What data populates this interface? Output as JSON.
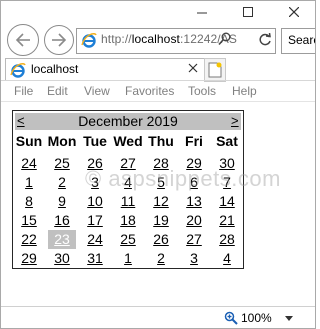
{
  "browser": {
    "url_prefix": "http://",
    "url_host": "localhost",
    "url_rest": ":12242/AS",
    "search_placeholder": "Search",
    "tab_title": "localhost",
    "menu": [
      "File",
      "Edit",
      "View",
      "Favorites",
      "Tools",
      "Help"
    ],
    "zoom": "100%"
  },
  "calendar": {
    "prev": "<",
    "next": ">",
    "title": "December 2019",
    "days_of_week": [
      "Sun",
      "Mon",
      "Tue",
      "Wed",
      "Thu",
      "Fri",
      "Sat"
    ],
    "weeks": [
      [
        "24",
        "25",
        "26",
        "27",
        "28",
        "29",
        "30"
      ],
      [
        "1",
        "2",
        "3",
        "4",
        "5",
        "6",
        "7"
      ],
      [
        "8",
        "9",
        "10",
        "11",
        "12",
        "13",
        "14"
      ],
      [
        "15",
        "16",
        "17",
        "18",
        "19",
        "20",
        "21"
      ],
      [
        "22",
        "23",
        "24",
        "25",
        "26",
        "27",
        "28"
      ],
      [
        "29",
        "30",
        "31",
        "1",
        "2",
        "3",
        "4"
      ]
    ],
    "today": "23",
    "today_bg": "#c0c0c0",
    "header_bg": "#c0c0c0"
  },
  "watermark": "© aspsnippets.com"
}
